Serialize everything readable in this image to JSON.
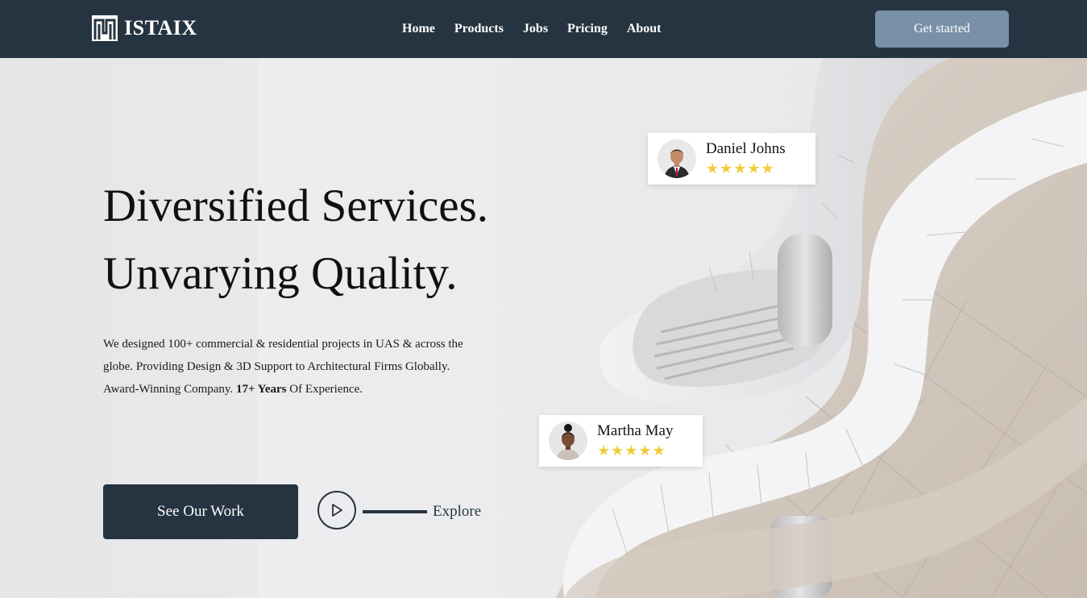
{
  "brand": {
    "name": "ISTAIX",
    "logo_icon": "istaix-logo-icon"
  },
  "nav": {
    "links": [
      "Home",
      "Products",
      "Jobs",
      "Pricing",
      "About"
    ],
    "cta_label": "Get started"
  },
  "hero": {
    "headline_line1": "Diversified Services.",
    "headline_line2": "Unvarying Quality.",
    "description_part1": "We designed 100+ commercial & residential projects in UAS & across the globe. Providing Design & 3D Support to Architectural Firms Globally. Award-Winning Company.",
    "description_bold": "17+ Years",
    "description_part2": "Of Experience.",
    "primary_button": "See Our Work",
    "play_icon": "play-icon",
    "explore_label": "Explore"
  },
  "reviews": [
    {
      "name": "Daniel Johns",
      "stars": "★★★★★",
      "rating": 5
    },
    {
      "name": "Martha May",
      "stars": "★★★★★",
      "rating": 5
    }
  ],
  "colors": {
    "navbar": "#263441",
    "cta_top": "#7891a8",
    "primary": "#263441",
    "star": "#f0cc3a"
  }
}
